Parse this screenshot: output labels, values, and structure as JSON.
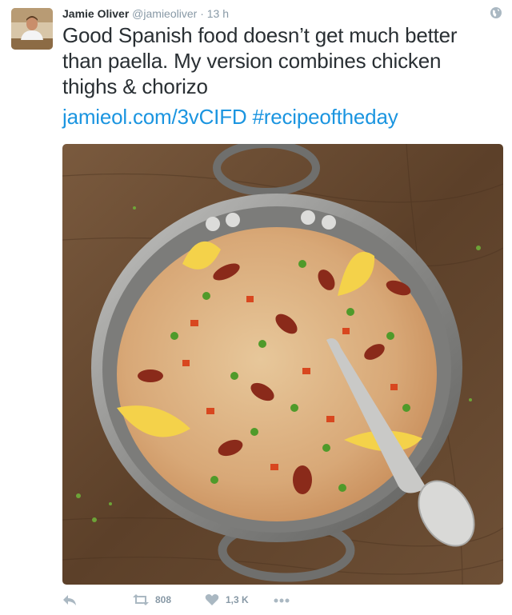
{
  "tweet": {
    "author_name": "Jamie Oliver",
    "handle": "@jamieoliver",
    "separator": "·",
    "time": "13 h",
    "text": "Good Spanish food doesn’t get much better than paella. My version combines chicken thighs & chorizo",
    "link": "jamieol.com/3vCIFD",
    "hashtag": "#recipeoftheday"
  },
  "actions": {
    "retweet_count": "808",
    "like_count": "1,3 K"
  },
  "colors": {
    "link": "#1b95e0",
    "muted": "#8899a6",
    "icon": "#aab8c2"
  },
  "icons": [
    "globe-icon",
    "reply-icon",
    "retweet-icon",
    "heart-icon",
    "more-icon"
  ]
}
